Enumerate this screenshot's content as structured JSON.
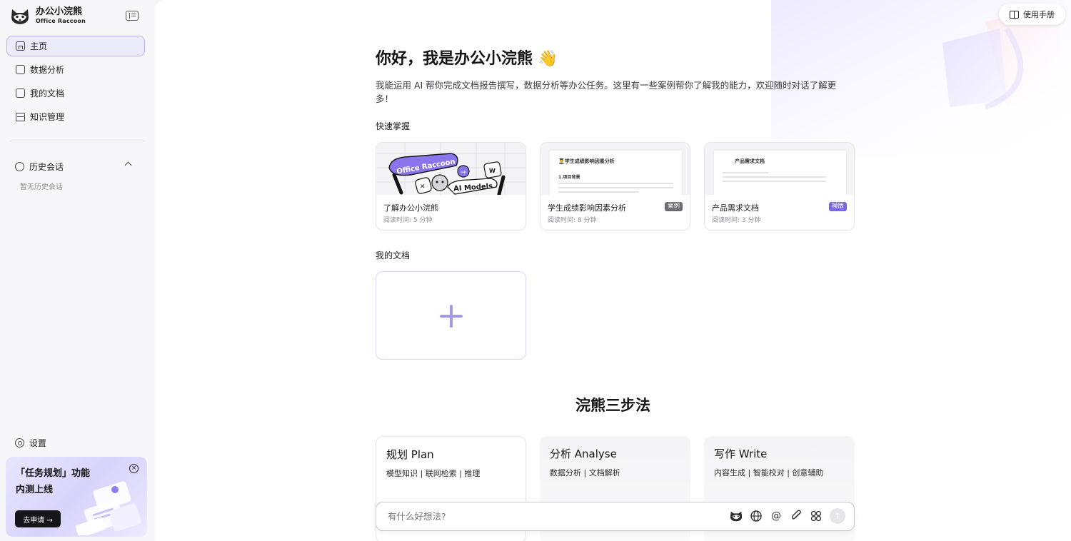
{
  "brand": {
    "name": "办公小浣熊",
    "sub": "Office Raccoon"
  },
  "nav": [
    {
      "label": "主页",
      "icon": "home-icon",
      "active": true
    },
    {
      "label": "数据分析",
      "icon": "chart-icon"
    },
    {
      "label": "我的文档",
      "icon": "document-icon"
    },
    {
      "label": "知识管理",
      "icon": "database-icon"
    }
  ],
  "history": {
    "title": "历史会话",
    "empty": "暂无历史会话"
  },
  "settings": {
    "label": "设置"
  },
  "promo": {
    "line1": "「任务规划」功能",
    "line2": "内测上线",
    "button": "去申请 →",
    "close": "×"
  },
  "header": {
    "manual": "使用手册"
  },
  "greeting": {
    "title": "你好，我是办公小浣熊 👋",
    "intro": "我能运用 AI 帮你完成文档报告撰写，数据分析等办公任务。这里有一些案例帮你了解我的能力，欢迎随时对话了解更多！"
  },
  "quick": {
    "title": "快速掌握",
    "cards": [
      {
        "title": "了解办公小浣熊",
        "meta": "阅读时间: 5 分钟",
        "badge": "",
        "art_text1": "Office Raccoon",
        "art_text2": "AI Models"
      },
      {
        "title": "学生成绩影响因素分析",
        "meta": "阅读时间: 8 分钟",
        "badge": "案例",
        "doc_title": "👨‍🎓学生成绩影响因素分析",
        "doc_sub": "1.项目背景"
      },
      {
        "title": "产品需求文档",
        "meta": "阅读时间: 3 分钟",
        "badge": "模版",
        "doc_title": "产品需求文档"
      }
    ]
  },
  "docs": {
    "title": "我的文档"
  },
  "steps": {
    "title": "浣熊三步法",
    "items": [
      {
        "title": "规划 Plan",
        "sub": "模型知识 | 联网检索 | 推理"
      },
      {
        "title": "分析 Analyse",
        "sub": "数据分析 | 文档解析"
      },
      {
        "title": "写作 Write",
        "sub": "内容生成 | 智能校对 | 创意辅助"
      }
    ]
  },
  "chat": {
    "placeholder": "有什么好想法?",
    "send": "↑"
  }
}
